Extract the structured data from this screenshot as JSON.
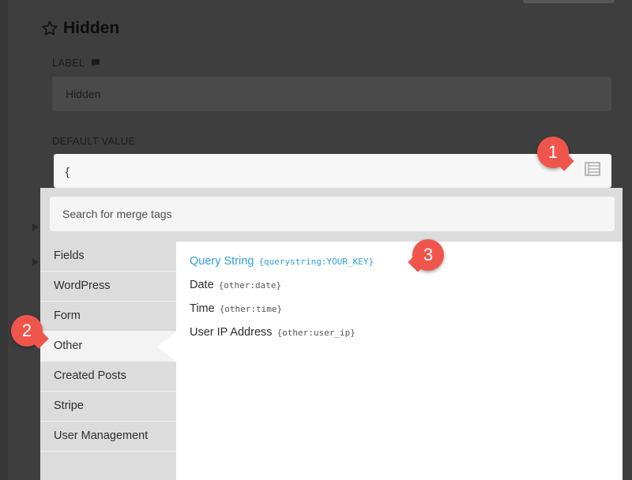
{
  "field": {
    "title": "Hidden",
    "label_heading": "LABEL",
    "label_value": "Hidden",
    "default_heading": "DEFAULT VALUE",
    "default_value": "{"
  },
  "merge_tags": {
    "search_placeholder": "Search for merge tags",
    "categories": [
      {
        "label": "Fields"
      },
      {
        "label": "WordPress"
      },
      {
        "label": "Form"
      },
      {
        "label": "Other"
      },
      {
        "label": "Created Posts"
      },
      {
        "label": "Stripe"
      },
      {
        "label": "User Management"
      }
    ],
    "active_category": "Other",
    "tags": [
      {
        "name": "Query String",
        "code": "{querystring:YOUR_KEY}"
      },
      {
        "name": "Date",
        "code": "{other:date}"
      },
      {
        "name": "Time",
        "code": "{other:time}"
      },
      {
        "name": "User IP Address",
        "code": "{other:user_ip}"
      }
    ]
  },
  "callouts": [
    {
      "number": "1"
    },
    {
      "number": "2"
    },
    {
      "number": "3"
    }
  ],
  "colors": {
    "accent_link": "#2f9fd9",
    "callout": "#f0554c",
    "overlay": "#3e3e3e"
  },
  "icons": {
    "star": "star-icon",
    "help": "help-bubble-icon",
    "merge": "merge-tags-icon"
  }
}
